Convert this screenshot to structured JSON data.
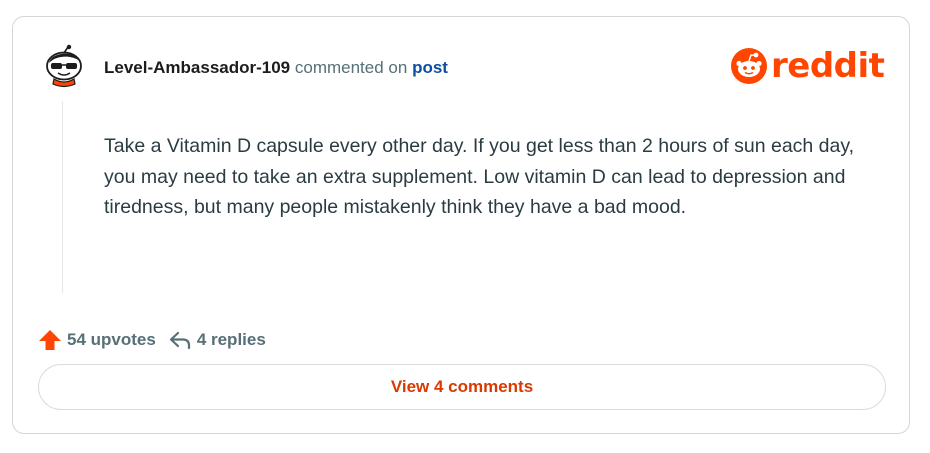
{
  "comment": {
    "username": "Level-Ambassador-109",
    "action_text": "commented on",
    "post_link_label": "post",
    "body": "Take a Vitamin D capsule every other day. If you get less than 2 hours of sun each day, you may need to take an extra supplement. Low vitamin D can lead to depression and tiredness, but many people mistakenly think they have a bad mood."
  },
  "brand": {
    "logo_text": "reddit",
    "color": "#ff4500"
  },
  "stats": {
    "upvotes_label": "54 upvotes",
    "replies_label": "4 replies"
  },
  "actions": {
    "view_comments_label": "View 4 comments"
  },
  "icons": {
    "avatar": "snoo-avatar",
    "logo": "reddit-snoo-icon",
    "upvote": "upvote-arrow-icon",
    "reply": "reply-arrow-icon"
  },
  "colors": {
    "accent": "#ff4500",
    "link": "#0a4fa3",
    "button_text": "#d93a00",
    "muted": "#576f76"
  }
}
